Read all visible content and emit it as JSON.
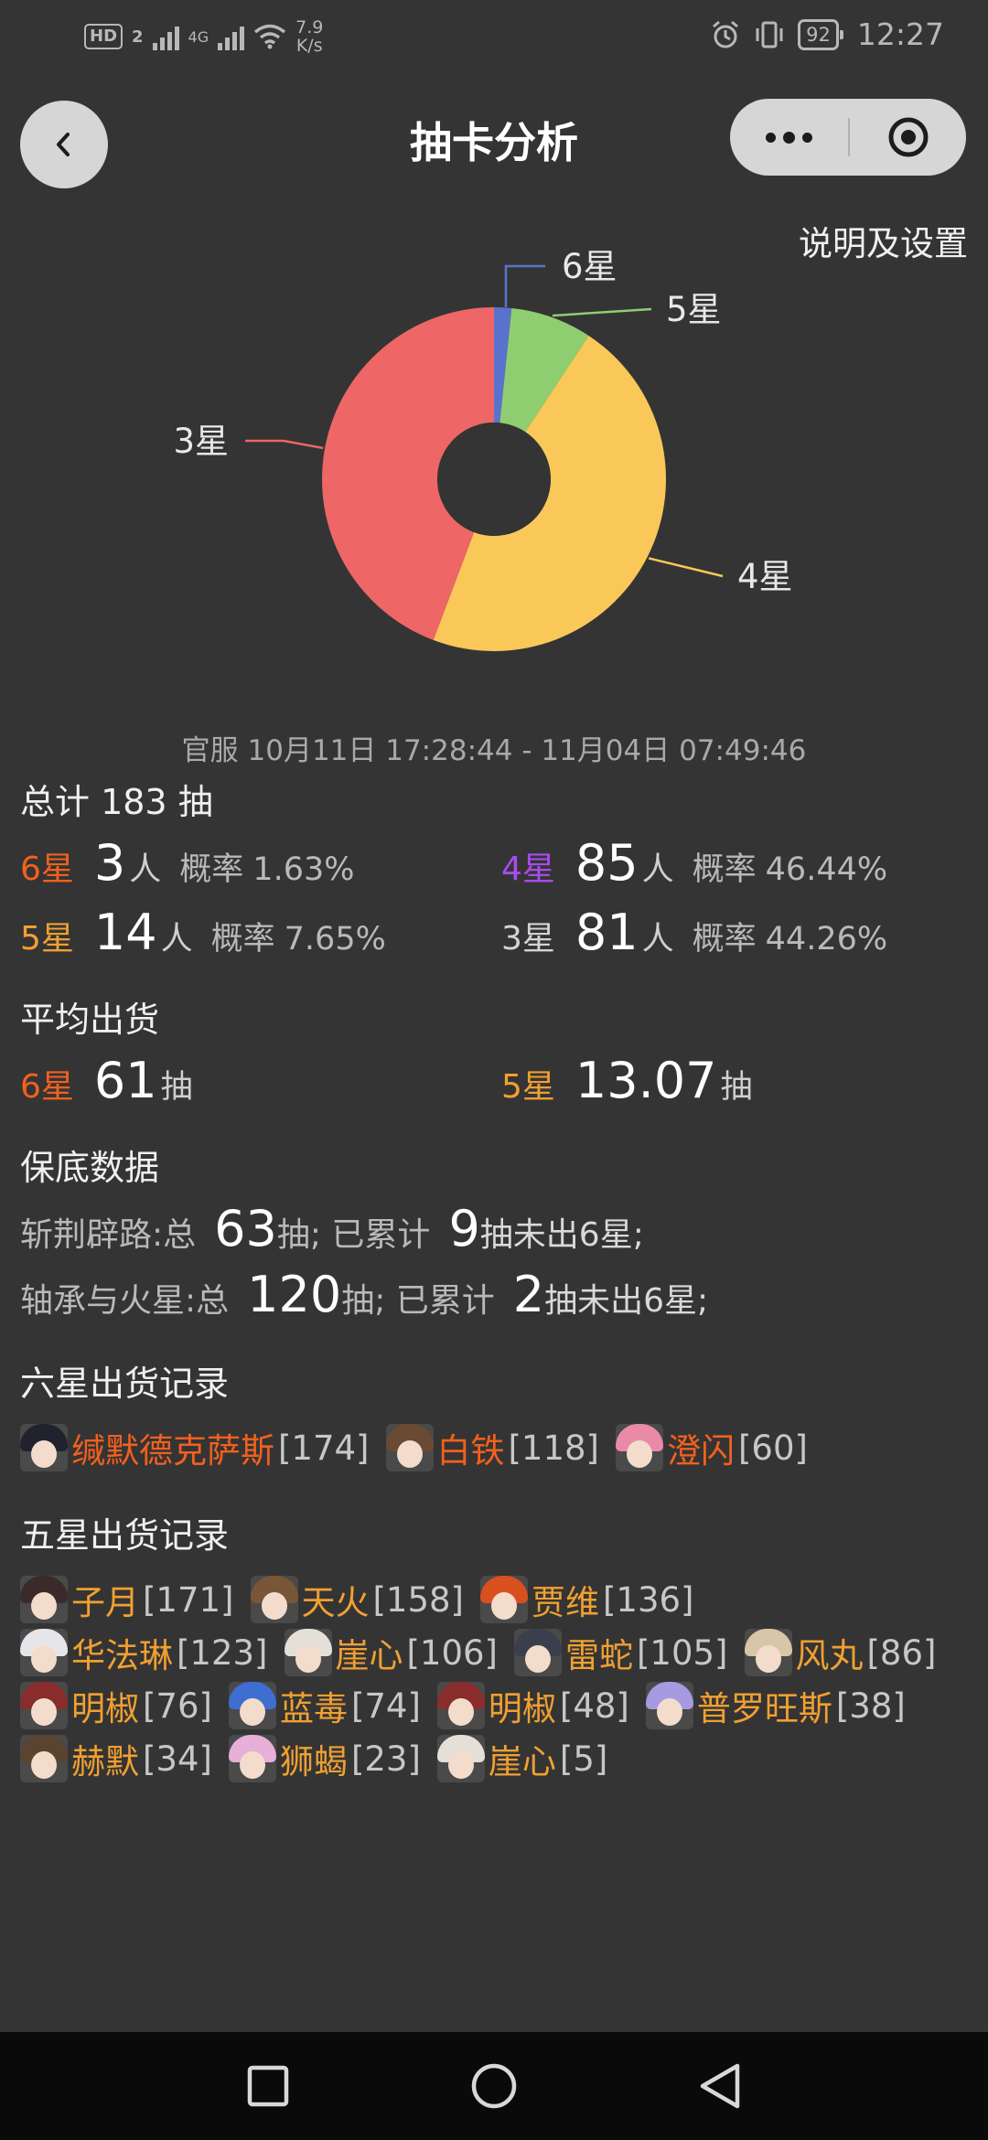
{
  "status_bar": {
    "hd_badge": "HD",
    "sim_badge": "2",
    "network_type": "4G",
    "speed_value": "7.9",
    "speed_unit": "K/s",
    "battery": "92",
    "time": "12:27",
    "icons": [
      "hd-icon",
      "signal-icon",
      "wifi-icon",
      "alarm-icon",
      "vibrate-icon",
      "battery-icon"
    ]
  },
  "header": {
    "title": "抽卡分析",
    "settings_link": "说明及设置",
    "icons": [
      "back-arrow-icon",
      "more-dots-icon",
      "target-circle-icon"
    ]
  },
  "chart_data": {
    "type": "pie",
    "donut": true,
    "categories": [
      "6星",
      "5星",
      "4星",
      "3星"
    ],
    "values": [
      3,
      14,
      85,
      81
    ],
    "colors": [
      "#5b72cc",
      "#8fce70",
      "#fac858",
      "#ee6666"
    ],
    "legend": "none"
  },
  "date_range": "官服  10月11日 17:28:44  -  11月04日 07:49:46",
  "totals": {
    "title": "总计 183 抽",
    "unit_person": "人",
    "rate_label": "概率",
    "six": {
      "star": "6星",
      "count": "3",
      "rate": "1.63%"
    },
    "four": {
      "star": "4星",
      "count": "85",
      "rate": "46.44%"
    },
    "five": {
      "star": "5星",
      "count": "14",
      "rate": "7.65%"
    },
    "three": {
      "star": "3星",
      "count": "81",
      "rate": "44.26%"
    }
  },
  "average": {
    "title": "平均出货",
    "unit": "抽",
    "six": {
      "star": "6星",
      "value": "61"
    },
    "five": {
      "star": "5星",
      "value": "13.07"
    }
  },
  "pity": {
    "title": "保底数据",
    "rows": [
      {
        "pool": "斩荆辟路:总",
        "total": "63",
        "mid": "抽;  已累计",
        "acc": "9",
        "tail": "抽未出6星;"
      },
      {
        "pool": "轴承与火星:总",
        "total": "120",
        "mid": "抽;  已累计",
        "acc": "2",
        "tail": "抽未出6星;"
      }
    ]
  },
  "six_star_records": {
    "title": "六星出货记录",
    "items": [
      {
        "name": "缄默德克萨斯",
        "pull": "[174]",
        "hair": "#20222e"
      },
      {
        "name": "白铁",
        "pull": "[118]",
        "hair": "#6b4a34"
      },
      {
        "name": "澄闪",
        "pull": "[60]",
        "hair": "#e88aa8"
      }
    ]
  },
  "five_star_records": {
    "title": "五星出货记录",
    "items": [
      {
        "name": "子月",
        "pull": "[171]",
        "hair": "#3a2a2a"
      },
      {
        "name": "天火",
        "pull": "[158]",
        "hair": "#7a5638"
      },
      {
        "name": "贾维",
        "pull": "[136]",
        "hair": "#d8501e"
      },
      {
        "name": "华法琳",
        "pull": "[123]",
        "hair": "#e6e6ea"
      },
      {
        "name": "崖心",
        "pull": "[106]",
        "hair": "#e4e0d8"
      },
      {
        "name": "雷蛇",
        "pull": "[105]",
        "hair": "#3a3f4e"
      },
      {
        "name": "风丸",
        "pull": "[86]",
        "hair": "#d8c6a8"
      },
      {
        "name": "明椒",
        "pull": "[76]",
        "hair": "#8a2c2c"
      },
      {
        "name": "蓝毒",
        "pull": "[74]",
        "hair": "#3d6ed0"
      },
      {
        "name": "明椒",
        "pull": "[48]",
        "hair": "#8a2c2c"
      },
      {
        "name": "普罗旺斯",
        "pull": "[38]",
        "hair": "#a89ae0"
      },
      {
        "name": "赫默",
        "pull": "[34]",
        "hair": "#5a4430"
      },
      {
        "name": "狮蝎",
        "pull": "[23]",
        "hair": "#e6b0d8"
      },
      {
        "name": "崖心",
        "pull": "[5]",
        "hair": "#e4e0d8"
      }
    ]
  }
}
